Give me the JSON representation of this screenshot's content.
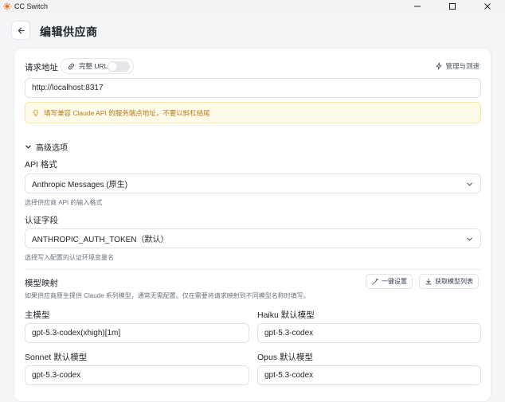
{
  "window": {
    "title": "CC Switch"
  },
  "header": {
    "title": "编辑供应商"
  },
  "request_url": {
    "label": "请求地址",
    "full_url_toggle_label": "完整 URL",
    "full_url_enabled": false,
    "manage_link": "管理与测速",
    "value": "http://localhost:8317",
    "warning": "填写兼容 Claude API 的服务端点地址，不要以斜杠结尾"
  },
  "advanced": {
    "toggle_label": "高级选项",
    "api_format": {
      "label": "API 格式",
      "selected": "Anthropic Messages (原生)",
      "hint": "选择供应商 API 的输入格式"
    },
    "auth_field": {
      "label": "认证字段",
      "selected": "ANTHROPIC_AUTH_TOKEN（默认）",
      "hint": "选择写入配置的认证环境变量名"
    }
  },
  "model_mapping": {
    "title": "模型映射",
    "hint": "如果供应商原生提供 Claude 系列模型，通常无需配置。仅在需要将请求映射到不同模型名称时填写。",
    "one_click_button": "一键设置",
    "fetch_button": "获取模型列表",
    "main_model": {
      "label": "主模型",
      "value": "gpt-5.3-codex(xhigh)[1m]"
    },
    "haiku_model": {
      "label": "Haiku 默认模型",
      "value": "gpt-5.3-codex"
    },
    "sonnet_model": {
      "label": "Sonnet 默认模型",
      "value": "gpt-5.3-codex"
    },
    "opus_model": {
      "label": "Opus 默认模型",
      "value": "gpt-5.3-codex"
    }
  },
  "colors": {
    "warning_bg": "#fefbe8",
    "warning_text": "#b7791f",
    "accent_orange": "#e8702a"
  },
  "icons": {
    "app": "cc-switch-logo-icon",
    "back": "arrow-left-icon",
    "link": "link-icon",
    "zap": "zap-icon",
    "info": "lightbulb-icon",
    "chevron": "chevron-down-icon",
    "wand": "magic-wand-icon",
    "download": "download-icon"
  }
}
